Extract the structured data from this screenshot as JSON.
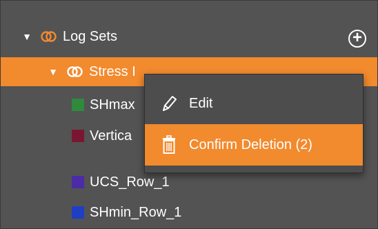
{
  "tree": {
    "root": {
      "label": "Log Sets",
      "expanded": true
    },
    "selected_node": {
      "label": "Stress I",
      "expanded": true
    },
    "add_button": {
      "symbol": "+"
    },
    "children": [
      {
        "label": "SHmax",
        "color": "#2f8a3c"
      },
      {
        "label": "Vertica",
        "color": "#7a1632"
      },
      {
        "label": "UCS_Row_1",
        "color": "#4b2ba6"
      },
      {
        "label": "SHmin_Row_1",
        "color": "#1e3fc4"
      }
    ]
  },
  "context_menu": {
    "edit_label": "Edit",
    "delete_label": "Confirm Deletion (2)"
  },
  "colors": {
    "panel_bg": "#535353",
    "accent_orange": "#f28a2e",
    "menu_bg": "#4d4d4d"
  },
  "icons": {
    "rings": "overlapping-rings-icon",
    "edit": "pencil-icon",
    "delete": "trash-icon",
    "add": "plus-circle-icon",
    "expand": "triangle-down-icon"
  }
}
